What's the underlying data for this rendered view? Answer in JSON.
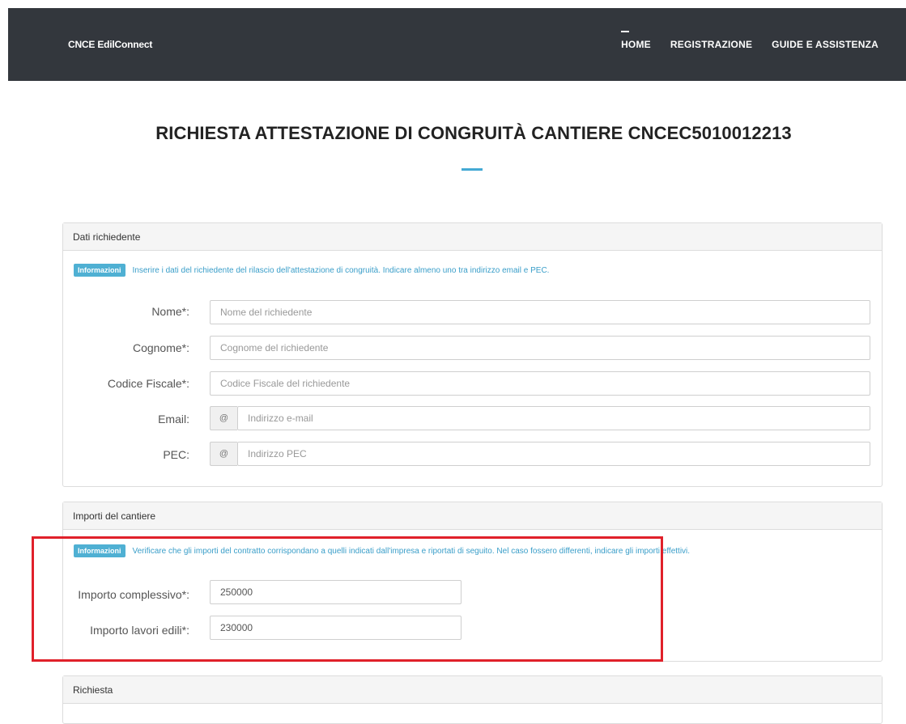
{
  "navbar": {
    "brand": "CNCE EdilConnect",
    "items": [
      {
        "label": "HOME",
        "active": true
      },
      {
        "label": "REGISTRAZIONE",
        "active": false
      },
      {
        "label": "GUIDE E ASSISTENZA",
        "active": false
      }
    ]
  },
  "page": {
    "title": "RICHIESTA ATTESTAZIONE DI CONGRUITÀ CANTIERE CNCEC5010012213"
  },
  "dati_richiedente": {
    "heading": "Dati richiedente",
    "info_badge": "Informazioni",
    "info_text": "Inserire i dati del richiedente del rilascio dell'attestazione di congruità. Indicare almeno uno tra indirizzo email e PEC.",
    "fields": {
      "nome": {
        "label": "Nome*:",
        "placeholder": "Nome del richiedente",
        "value": ""
      },
      "cognome": {
        "label": "Cognome*:",
        "placeholder": "Cognome del richiedente",
        "value": ""
      },
      "codice_fiscale": {
        "label": "Codice Fiscale*:",
        "placeholder": "Codice Fiscale del richiedente",
        "value": ""
      },
      "email": {
        "label": "Email:",
        "addon": "@",
        "placeholder": "Indirizzo e-mail",
        "value": ""
      },
      "pec": {
        "label": "PEC:",
        "addon": "@",
        "placeholder": "Indirizzo PEC",
        "value": ""
      }
    }
  },
  "importi": {
    "heading": "Importi del cantiere",
    "info_badge": "Informazioni",
    "info_text": "Verificare che gli importi del contratto corrispondano a quelli indicati dall'impresa e riportati di seguito. Nel caso fossero differenti, indicare gli importi effettivi.",
    "fields": {
      "complessivo": {
        "label": "Importo complessivo*:",
        "value": "250000"
      },
      "lavori_edili": {
        "label": "Importo lavori edili*:",
        "value": "230000"
      }
    }
  },
  "richiesta": {
    "heading": "Richiesta"
  },
  "colors": {
    "navbar_bg": "#33373d",
    "accent": "#44a9d4",
    "highlight": "#e0202a"
  }
}
